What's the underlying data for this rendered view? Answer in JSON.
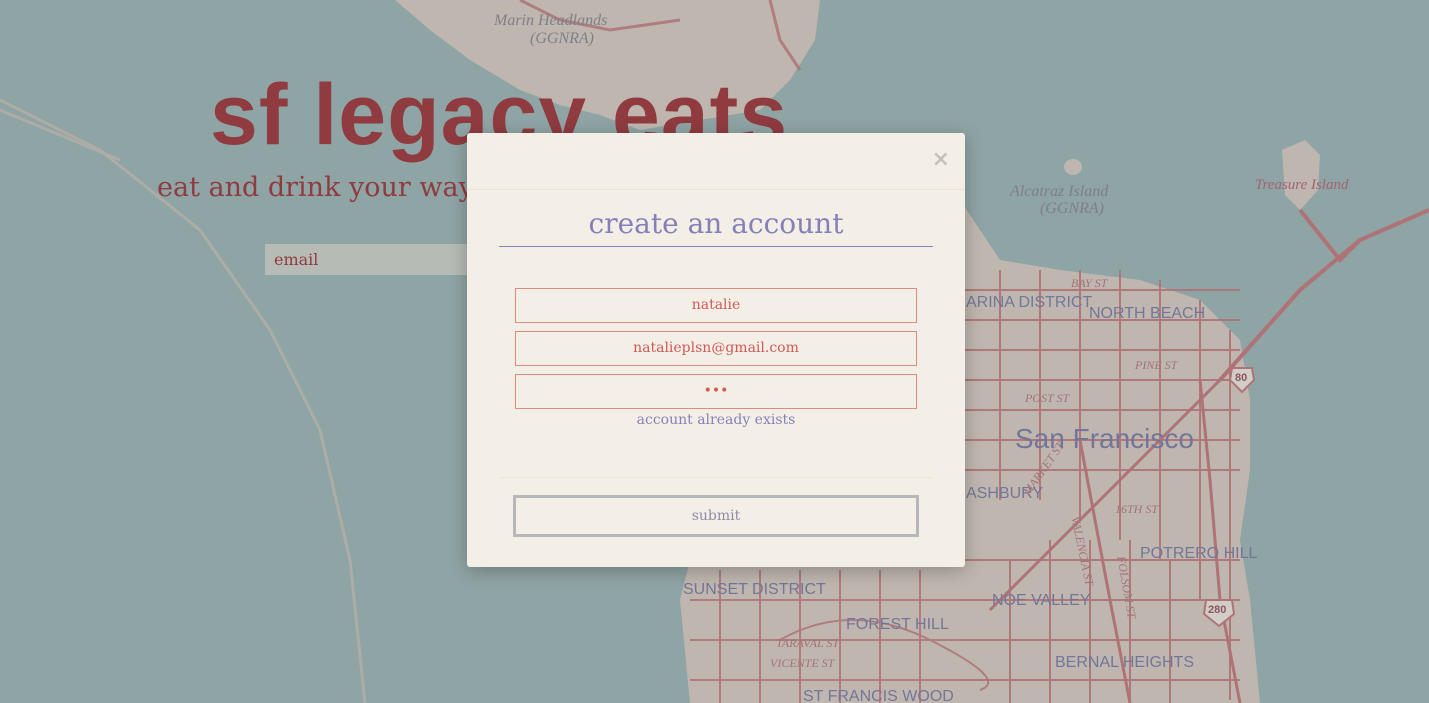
{
  "map": {
    "labels": {
      "marin_headlands": "Marin Headlands",
      "marin_ggnra": "(GGNRA)",
      "alcatraz": "Alcatraz Island",
      "alcatraz_ggnra": "(GGNRA)",
      "treasure_island": "Treasure Island",
      "marina_district": "ARINA DISTRICT",
      "north_beach": "NORTH BEACH",
      "san_francisco": "San Francisco",
      "haight_ashbury": "ASHBURY",
      "potrero_hill": "POTRERO HILL",
      "sunset_district": "SUNSET DISTRICT",
      "noe_valley": "NOE VALLEY",
      "forest_hill": "FOREST HILL",
      "bernal_heights": "BERNAL HEIGHTS",
      "st_francis_wood": "ST FRANCIS WOOD",
      "bay_st": "BAY ST",
      "post_st": "POST ST",
      "pine_st": "PINE ST",
      "market_st": "MARKET ST",
      "valencia_st": "VALENCIA ST",
      "folsom_st": "FOLSOM ST",
      "sixteenth_st": "16TH ST",
      "taraval_st": "TARAVAL ST",
      "vicente_st": "VICENTE ST",
      "highway_80": "80",
      "highway_280": "280"
    },
    "colors": {
      "water": "#9fb7b6",
      "land": "#d9cfc3",
      "roads": "#c57b7e",
      "labels": "#7d7fa6"
    }
  },
  "page": {
    "title": "sf legacy eats",
    "tagline": "eat and drink your way",
    "login_email_placeholder": "email"
  },
  "modal": {
    "close_symbol": "×",
    "title": "create an account",
    "fields": {
      "username_value": "natalie",
      "email_value": "natalieplsn@gmail.com",
      "password_masked": "•••"
    },
    "error_message": "account already exists",
    "submit_label": "submit"
  },
  "colors": {
    "title_red": "#8f3b3f",
    "modal_bg": "#f4efe6",
    "accent_purple": "#8581b8",
    "field_border": "#de8b7c",
    "field_text": "#cf5a55"
  }
}
